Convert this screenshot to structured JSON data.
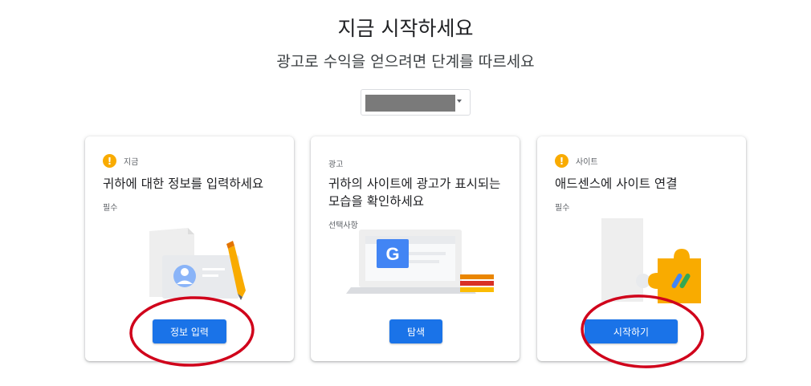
{
  "header": {
    "title": "지금 시작하세요",
    "subtitle": "광고로 수익을 얻으려면 단계를 따르세요"
  },
  "site_select": {
    "selected": ""
  },
  "cards": [
    {
      "status": "지금",
      "heading": "귀하에 대한 정보를 입력하세요",
      "requirement": "필수",
      "button": "정보 입력",
      "icon": "exclamation-icon"
    },
    {
      "status": "광고",
      "heading": "귀하의 사이트에 광고가 표시되는 모습을 확인하세요",
      "requirement": "선택사항",
      "button": "탐색"
    },
    {
      "status": "사이트",
      "heading": "애드센스에 사이트 연결",
      "requirement": "필수",
      "button": "시작하기",
      "icon": "exclamation-icon"
    }
  ],
  "colors": {
    "primary": "#1a73e8",
    "warning": "#f9ab00",
    "annotation": "#d0021b"
  }
}
